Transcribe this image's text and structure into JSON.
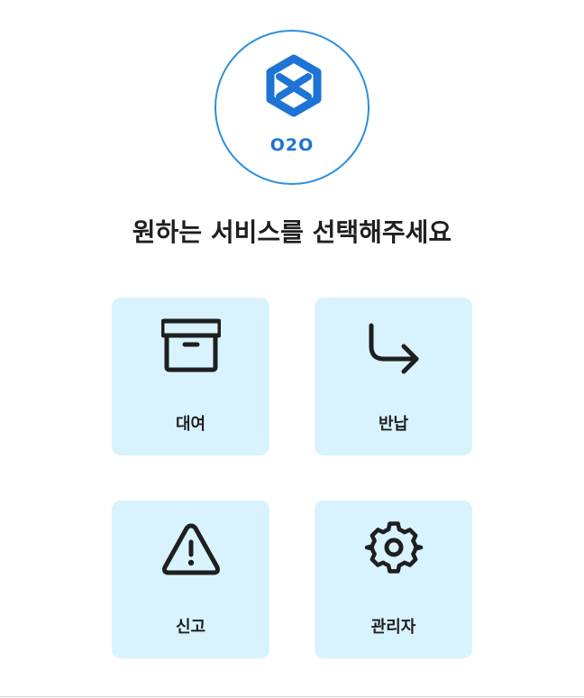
{
  "brand": {
    "logo_text": "O2O",
    "accent_color": "#1d74d4",
    "ring_color": "#2f8fdc",
    "logo_icon": "hexagon-logo-icon"
  },
  "heading": {
    "title": "원하는 서비스를 선택해주세요"
  },
  "services": [
    {
      "label": "대여",
      "icon": "archive-box-icon"
    },
    {
      "label": "반납",
      "icon": "return-arrow-icon"
    },
    {
      "label": "신고",
      "icon": "warning-triangle-icon"
    },
    {
      "label": "관리자",
      "icon": "gear-icon"
    }
  ],
  "tile_color": "#d8f3fd"
}
